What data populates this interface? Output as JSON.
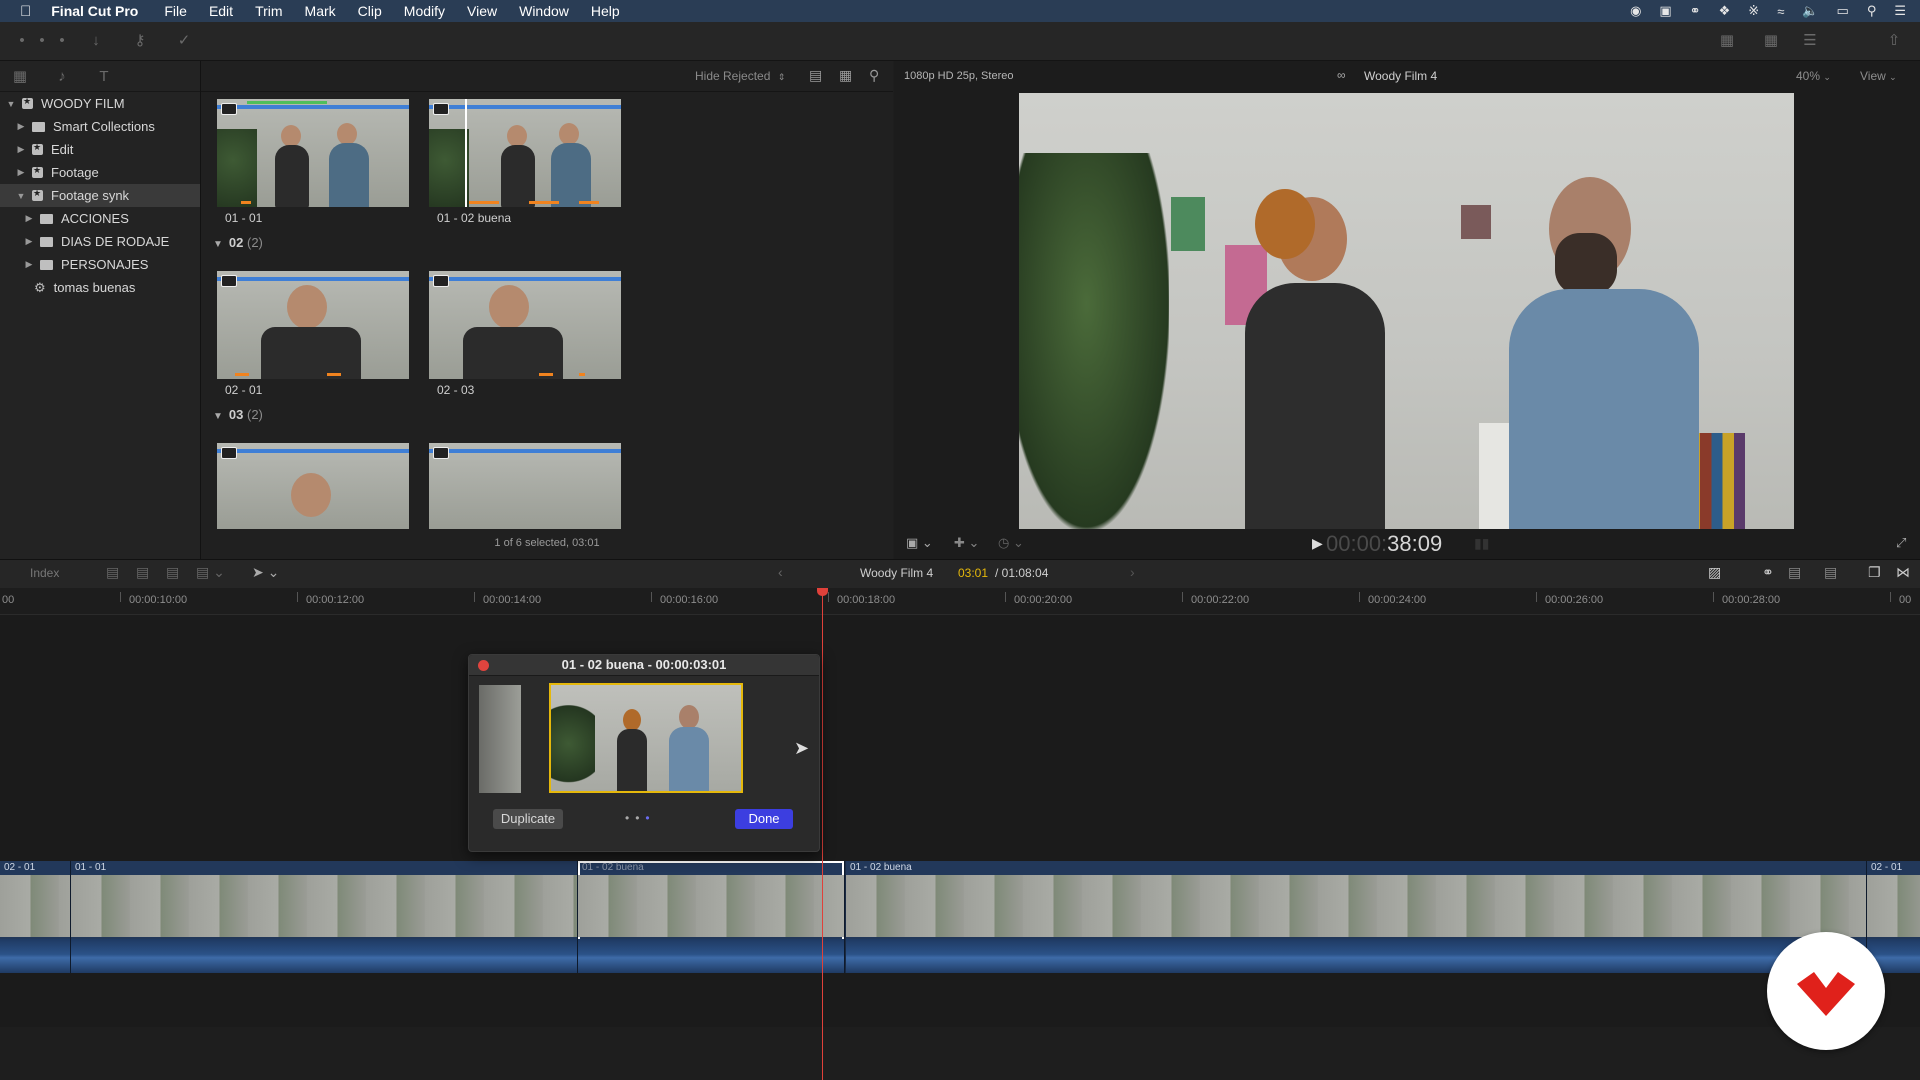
{
  "menubar": {
    "app_name": "Final Cut Pro",
    "items": [
      "File",
      "Edit",
      "Trim",
      "Mark",
      "Clip",
      "Modify",
      "View",
      "Window",
      "Help"
    ]
  },
  "library": {
    "items": [
      {
        "label": "WOODY FILM",
        "kind": "library",
        "expanded": true
      },
      {
        "label": "Smart Collections",
        "kind": "folder"
      },
      {
        "label": "Edit",
        "kind": "event"
      },
      {
        "label": "Footage",
        "kind": "event"
      },
      {
        "label": "Footage synk",
        "kind": "event",
        "selected": true,
        "expanded": true
      },
      {
        "label": "ACCIONES",
        "kind": "folder"
      },
      {
        "label": "DIAS DE RODAJE",
        "kind": "folder"
      },
      {
        "label": "PERSONAJES",
        "kind": "folder"
      },
      {
        "label": "tomas buenas",
        "kind": "smart"
      }
    ]
  },
  "browser": {
    "filter_label": "Hide Rejected",
    "status": "1 of 6 selected, 03:01",
    "clips": [
      {
        "label": "01 - 01"
      },
      {
        "label": "01 - 02 buena"
      },
      {
        "label": "02 - 01"
      },
      {
        "label": "02 - 03"
      }
    ],
    "groups": [
      {
        "name": "02",
        "count": "(2)"
      },
      {
        "name": "03",
        "count": "(2)"
      }
    ]
  },
  "viewer": {
    "format": "1080p HD 25p, Stereo",
    "title": "Woody Film 4",
    "zoom": "40%",
    "view_label": "View",
    "timecode_dim": "00:00:",
    "timecode_bright": "38:09"
  },
  "timeline": {
    "index_label": "Index",
    "project_name": "Woody Film 4",
    "duration_current": "03:01",
    "duration_total": "/ 01:08:04",
    "ruler_ticks": [
      "00",
      "00:00:10:00",
      "00:00:12:00",
      "00:00:14:00",
      "00:00:16:00",
      "00:00:18:00",
      "00:00:20:00",
      "00:00:22:00",
      "00:00:24:00",
      "00:00:26:00",
      "00:00:28:00",
      "00"
    ],
    "clips": [
      {
        "label": "02 - 01"
      },
      {
        "label": "01 - 01"
      },
      {
        "label": "01 - 02 buena"
      },
      {
        "label": "01 - 02 buena"
      },
      {
        "label": "02 - 01"
      }
    ]
  },
  "popup": {
    "title": "01 - 02 buena - 00:00:03:01",
    "duplicate_label": "Duplicate",
    "done_label": "Done"
  },
  "colors": {
    "accent": "#e5b80b",
    "done_button": "#3c3ee0",
    "playhead": "#e0413a",
    "timecode_yellow": "#e5b80b",
    "menubar": "#2a3d55"
  }
}
